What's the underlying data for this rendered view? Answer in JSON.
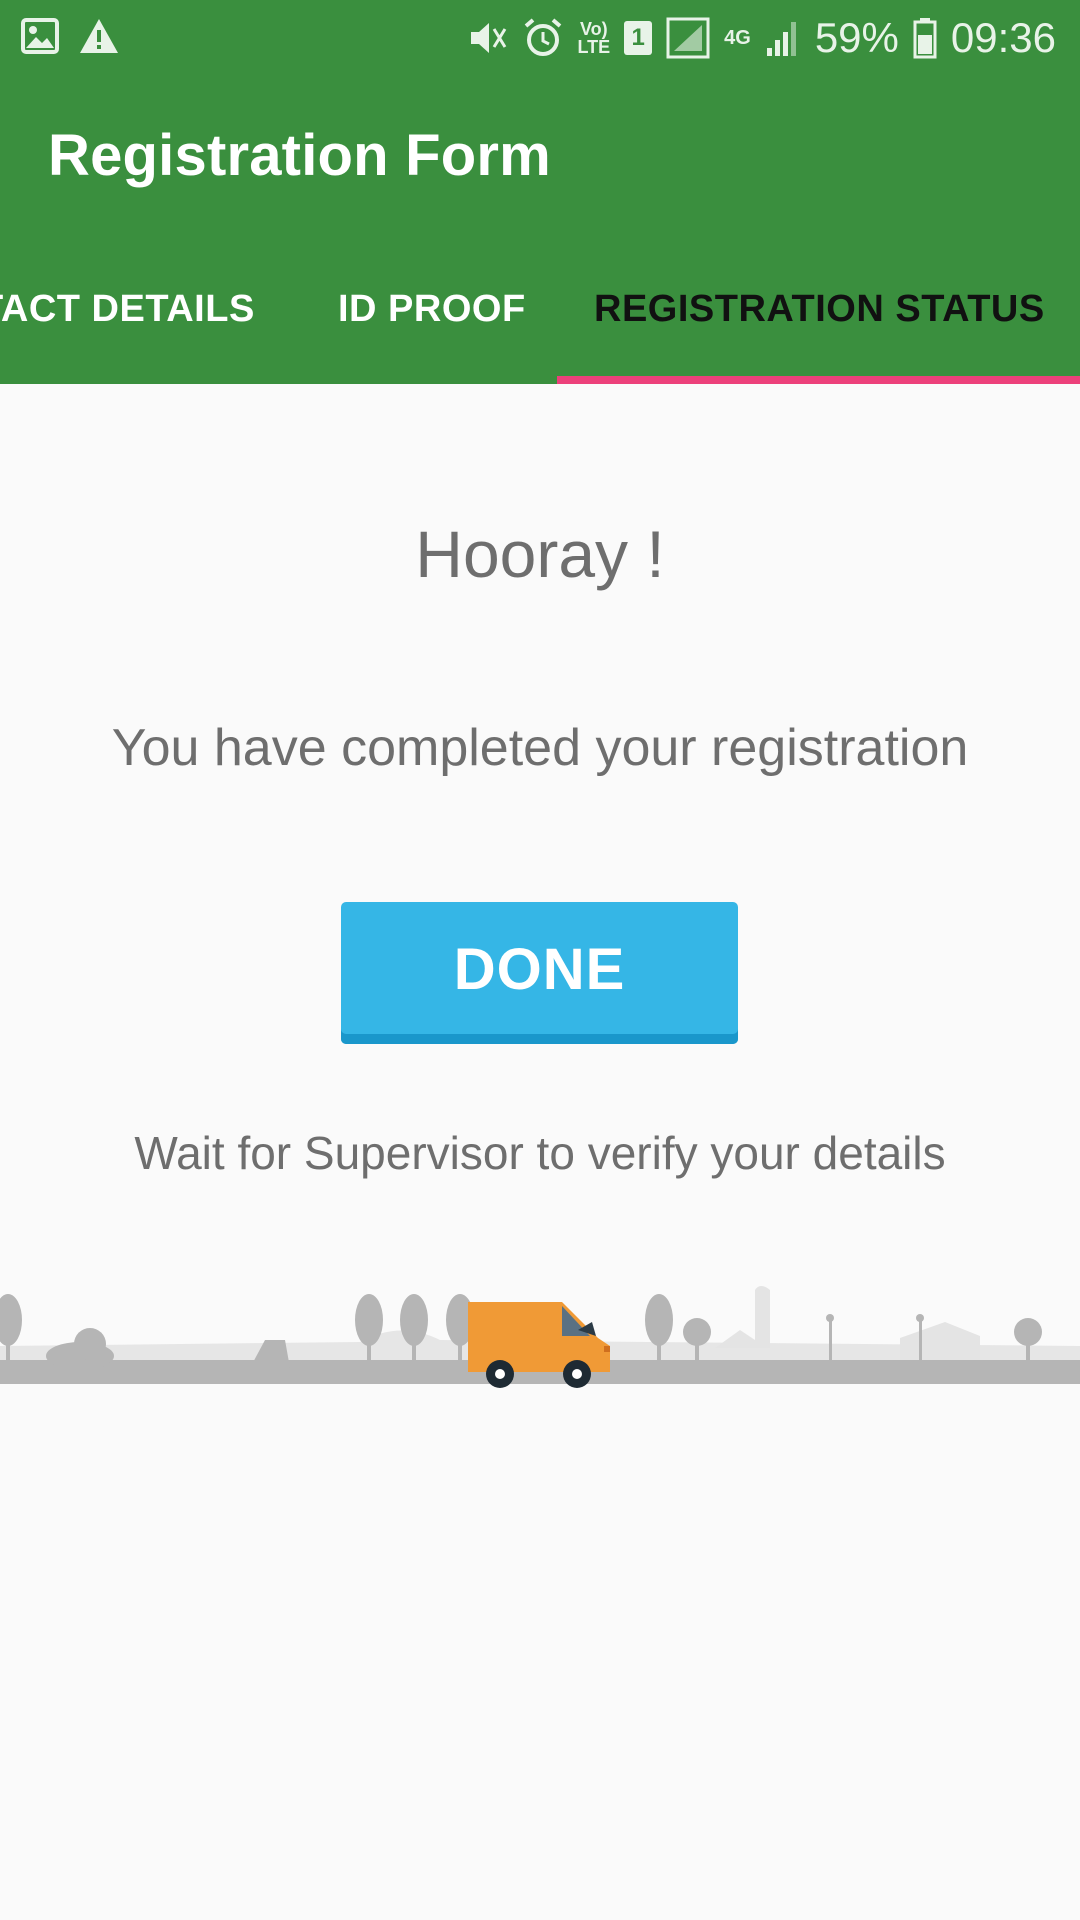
{
  "status_bar": {
    "battery_percent": "59%",
    "time": "09:36",
    "network": "4G",
    "volte": "VoLTE",
    "sim": "1",
    "icons": [
      "image-icon",
      "warning-icon",
      "mute-icon",
      "alarm-icon",
      "volte-icon",
      "sim-icon",
      "signal-icon",
      "data-4g-icon",
      "signal-icon",
      "battery-icon"
    ]
  },
  "header": {
    "title": "Registration Form"
  },
  "tabs": [
    {
      "label": "CONTACT DETAILS",
      "visible_label": "TACT DETAILS",
      "selected": false
    },
    {
      "label": "ID PROOF",
      "selected": false
    },
    {
      "label": "REGISTRATION STATUS",
      "selected": true
    }
  ],
  "main": {
    "heading": "Hooray !",
    "message": "You have completed your registration",
    "done_button": "DONE",
    "note": "Wait for Supervisor to verify your details"
  },
  "colors": {
    "appbar": "#3a8f3e",
    "tab_indicator": "#ec407a",
    "button": "#35b6e6",
    "truck": "#f09a36"
  },
  "illustration": {
    "icon": "delivery-truck-icon"
  }
}
